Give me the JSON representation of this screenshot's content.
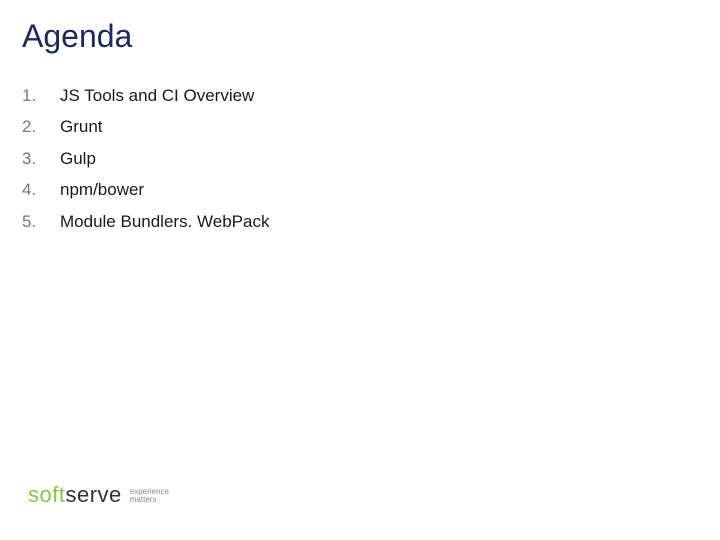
{
  "slide": {
    "title": "Agenda",
    "items": [
      "JS Tools and CI Overview",
      "Grunt",
      "Gulp",
      "npm/bower",
      "Module Bundlers. WebPack"
    ]
  },
  "logo": {
    "part1": "soft",
    "part2": "serve",
    "tagline1": "experience",
    "tagline2": "matters"
  }
}
